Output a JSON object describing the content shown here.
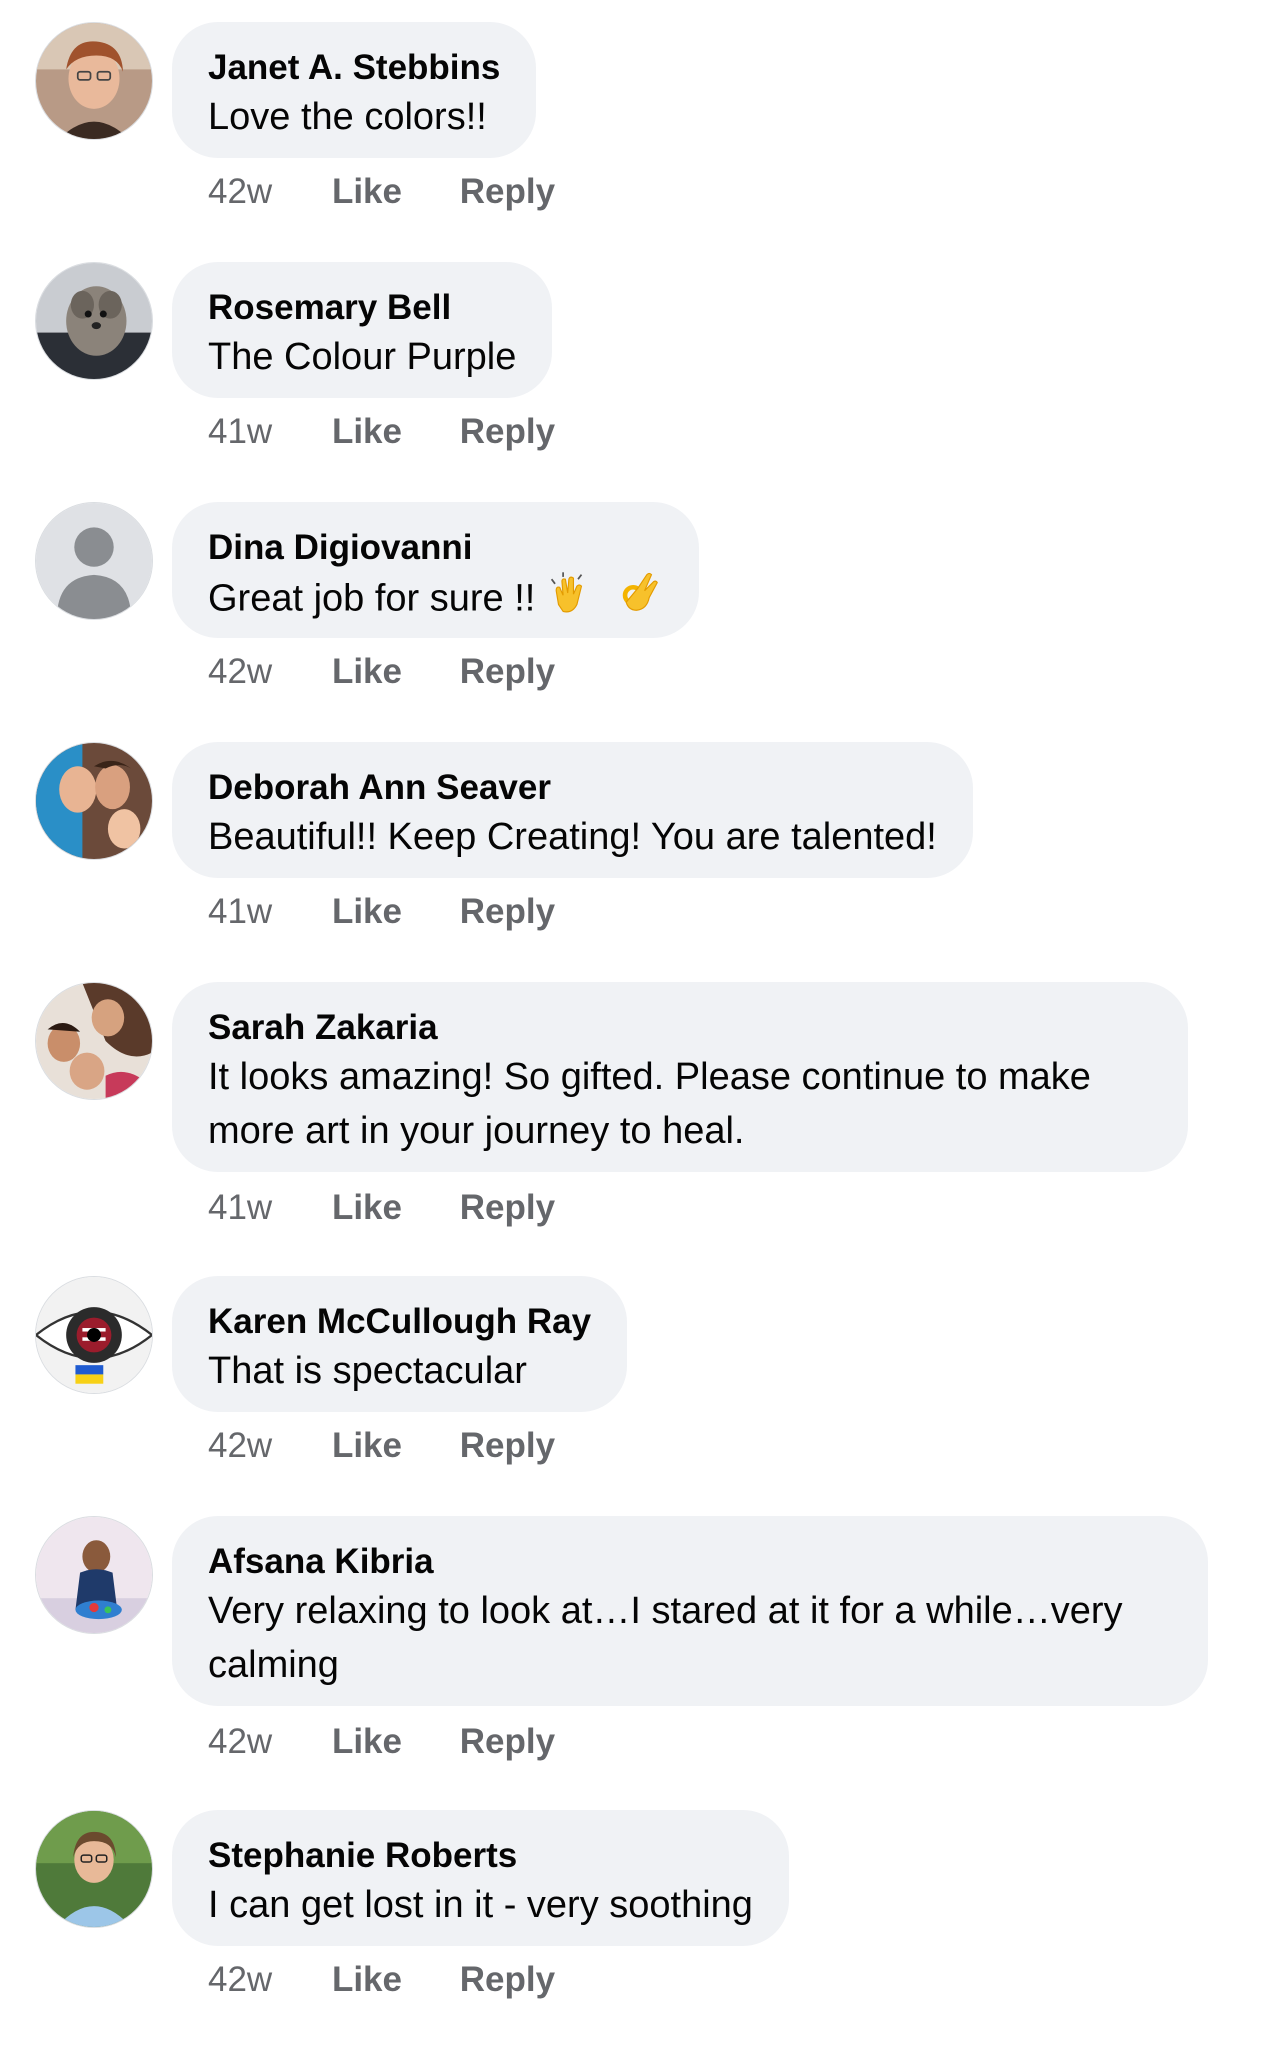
{
  "comments": [
    {
      "author": "Janet A. Stebbins",
      "text": "Love the colors!!",
      "time": "42w",
      "like": "Like",
      "reply": "Reply"
    },
    {
      "author": "Rosemary Bell",
      "text": "The Colour Purple",
      "time": "41w",
      "like": "Like",
      "reply": "Reply"
    },
    {
      "author": "Dina Digiovanni",
      "text": "Great job for sure !!",
      "time": "42w",
      "like": "Like",
      "reply": "Reply"
    },
    {
      "author": "Deborah Ann Seaver",
      "text": "Beautiful!! Keep Creating! You are talented!",
      "time": "41w",
      "like": "Like",
      "reply": "Reply"
    },
    {
      "author": "Sarah Zakaria",
      "text": "It looks amazing! So gifted. Please continue to make more art in your journey to heal.",
      "time": "41w",
      "like": "Like",
      "reply": "Reply"
    },
    {
      "author": "Karen McCullough Ray",
      "text": "That is spectacular",
      "time": "42w",
      "like": "Like",
      "reply": "Reply"
    },
    {
      "author": "Afsana Kibria",
      "text": "Very relaxing to look at…I stared at it for a while…very calming",
      "time": "42w",
      "like": "Like",
      "reply": "Reply"
    },
    {
      "author": "Stephanie Roberts",
      "text": "I can get lost in it - very soothing",
      "time": "42w",
      "like": "Like",
      "reply": "Reply"
    }
  ],
  "icons": {
    "clapping": "clapping-hands-emoji",
    "ok": "ok-hand-emoji"
  }
}
